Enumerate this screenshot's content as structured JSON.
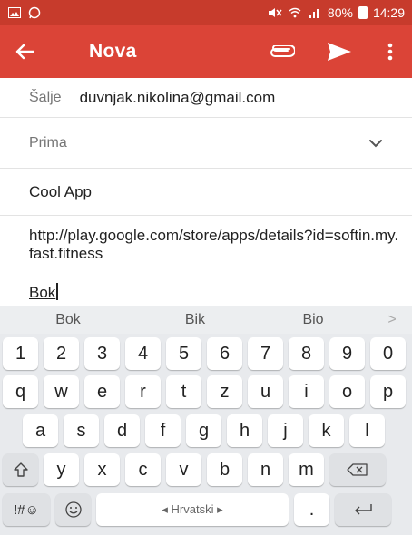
{
  "status_bar": {
    "time": "14:29",
    "battery": "80%",
    "left_icons": [
      "image-icon",
      "whatsapp-icon"
    ],
    "right_icons": [
      "mute-icon",
      "wifi-icon",
      "signal-icon",
      "battery-icon"
    ]
  },
  "app_bar": {
    "title": "Nova",
    "back_icon": "arrow-back-icon",
    "attach_icon": "attach-icon",
    "send_icon": "send-icon",
    "more_icon": "more-vert-icon",
    "background": "#db4437",
    "status_background": "#c73b2c"
  },
  "compose": {
    "from_label": "Šalje",
    "from_value": "duvnjak.nikolina@gmail.com",
    "to_label": "Prima",
    "subject": "Cool App",
    "body": "http://play.google.com/store/apps/details?id=softin.my.fast.fitness",
    "reply_text": "Bok"
  },
  "keyboard": {
    "suggestions": [
      "Bok",
      "Bik",
      "Bio"
    ],
    "more": ">",
    "row_numbers": [
      "1",
      "2",
      "3",
      "4",
      "5",
      "6",
      "7",
      "8",
      "9",
      "0"
    ],
    "row_1": [
      "q",
      "w",
      "e",
      "r",
      "t",
      "z",
      "u",
      "i",
      "o",
      "p"
    ],
    "row_2": [
      "a",
      "s",
      "d",
      "f",
      "g",
      "h",
      "j",
      "k",
      "l"
    ],
    "row_3": [
      "y",
      "x",
      "c",
      "v",
      "b",
      "n",
      "m"
    ],
    "symbols_label": "!#☺",
    "space_label": "◂ Hrvatski ▸",
    "period": "."
  }
}
